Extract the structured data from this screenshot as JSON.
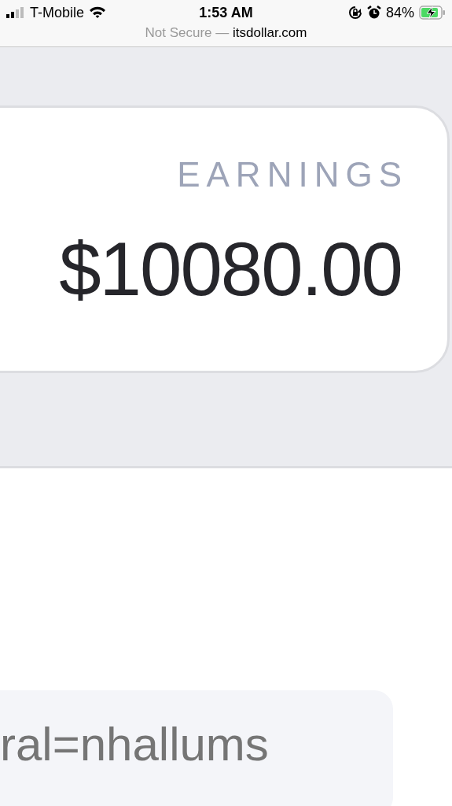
{
  "status_bar": {
    "carrier": "T-Mobile",
    "time": "1:53 AM",
    "battery": "84%"
  },
  "address_bar": {
    "security": "Not Secure —",
    "domain": "itsdollar.com"
  },
  "earnings_card": {
    "label": "EARNINGS",
    "amount": "$10080.00"
  },
  "referral_field": {
    "value": "ral=nhallums"
  }
}
